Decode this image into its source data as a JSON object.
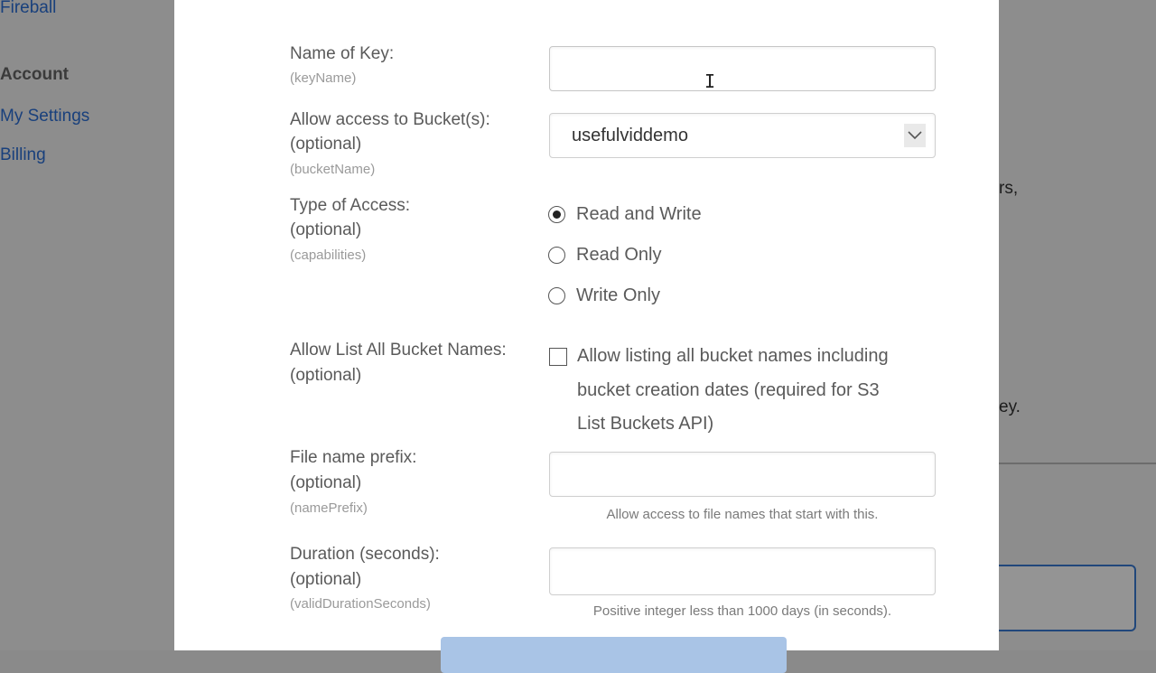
{
  "background": {
    "nav": {
      "fireball": "Fireball",
      "account_heading": "Account",
      "my_settings": "My Settings",
      "billing": "Billing"
    },
    "fragments": {
      "right_top": "rs,",
      "right_mid": "ey."
    }
  },
  "form": {
    "key_name": {
      "label": "Name of Key:",
      "param": "(keyName)",
      "value": ""
    },
    "bucket": {
      "label_line1": "Allow access to Bucket(s):",
      "label_line2": "(optional)",
      "param": "(bucketName)",
      "selected": "usefulviddemo"
    },
    "access_type": {
      "label_line1": "Type of Access:",
      "label_line2": "(optional)",
      "param": "(capabilities)",
      "options": [
        {
          "label": "Read and Write",
          "selected": true
        },
        {
          "label": "Read Only",
          "selected": false
        },
        {
          "label": "Write Only",
          "selected": false
        }
      ]
    },
    "list_all": {
      "label_line1": "Allow List All Bucket Names:",
      "label_line2": "(optional)",
      "checkbox_text_line1": "Allow listing all bucket names including",
      "checkbox_text_line2": "bucket creation dates (required for S3",
      "checkbox_text_line3": "List Buckets API)",
      "checked": false
    },
    "prefix": {
      "label_line1": "File name prefix:",
      "label_line2": "(optional)",
      "param": "(namePrefix)",
      "value": "",
      "hint": "Allow access to file names that start with this."
    },
    "duration": {
      "label_line1": "Duration (seconds):",
      "label_line2": "(optional)",
      "param": "(validDurationSeconds)",
      "value": "",
      "hint": "Positive integer less than 1000 days (in seconds)."
    }
  },
  "colors": {
    "link": "#2b6fd6",
    "submit": "#a9c4e6"
  }
}
